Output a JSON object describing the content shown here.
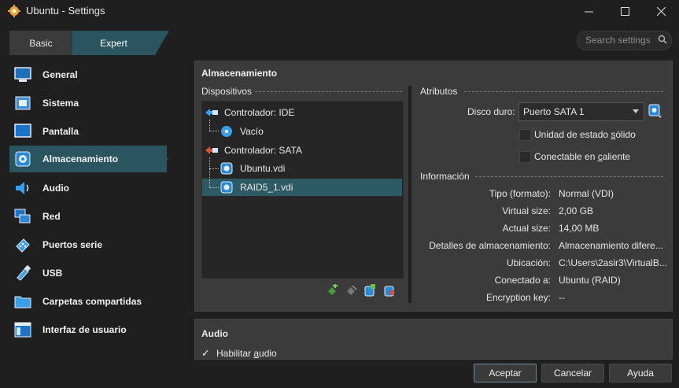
{
  "window": {
    "title": "Ubuntu - Settings",
    "controls": [
      "minimize-icon",
      "maximize-icon",
      "close-icon"
    ]
  },
  "mode": {
    "basic": "Basic",
    "expert": "Expert",
    "selected": "Expert"
  },
  "search": {
    "placeholder": "Search settings",
    "icon": "search-icon"
  },
  "sidebar": {
    "items": [
      {
        "label": "General",
        "icon": "monitor-icon"
      },
      {
        "label": "Sistema",
        "icon": "chip-icon"
      },
      {
        "label": "Pantalla",
        "icon": "display-icon"
      },
      {
        "label": "Almacenamiento",
        "icon": "disk-icon",
        "active": true
      },
      {
        "label": "Audio",
        "icon": "speaker-icon"
      },
      {
        "label": "Red",
        "icon": "network-icon"
      },
      {
        "label": "Puertos serie",
        "icon": "serial-port-icon"
      },
      {
        "label": "USB",
        "icon": "usb-icon"
      },
      {
        "label": "Carpetas compartidas",
        "icon": "folder-icon"
      },
      {
        "label": "Interfaz de usuario",
        "icon": "window-icon"
      }
    ]
  },
  "storage": {
    "title": "Almacenamiento",
    "devices_label": "Dispositivos",
    "tree": [
      {
        "label": "Controlador: IDE",
        "icon": "ide-controller-icon"
      },
      {
        "label": "Vacío",
        "icon": "optical-disk-icon"
      },
      {
        "label": "Controlador: SATA",
        "icon": "sata-controller-icon"
      },
      {
        "label": "Ubuntu.vdi",
        "icon": "hard-disk-icon"
      },
      {
        "label": "RAID5_1.vdi",
        "icon": "hard-disk-icon",
        "selected": true
      }
    ],
    "toolbar_icons": [
      "add-controller-icon",
      "remove-controller-icon",
      "add-attachment-icon",
      "remove-attachment-icon"
    ],
    "attributes": {
      "label": "Atributos",
      "disk_label": "Disco duro:",
      "disk_value": "Puerto SATA 1",
      "ssd_label_pre": "Unidad de estado ",
      "ssd_label_u": "s",
      "ssd_label_post": "ólido",
      "ssd_checked": false,
      "hot_label_pre": "Conectable en ",
      "hot_label_u": "c",
      "hot_label_post": "aliente",
      "hot_checked": false
    },
    "info": {
      "label": "Información",
      "rows": [
        {
          "key": "Tipo (formato):",
          "value": "Normal (VDI)"
        },
        {
          "key": "Virtual size:",
          "value": "2,00 GB"
        },
        {
          "key": "Actual size:",
          "value": "14,00 MB"
        },
        {
          "key": "Detalles de almacenamiento:",
          "value": "Almacenamiento difere..."
        },
        {
          "key": "Ubicación:",
          "value": "C:\\Users\\2asir3\\VirtualB..."
        },
        {
          "key": "Conectado a:",
          "value": "Ubuntu (RAID)"
        },
        {
          "key": "Encryption key:",
          "value": "--"
        }
      ]
    }
  },
  "audio": {
    "title": "Audio",
    "enable_pre": "Habilitar ",
    "enable_u": "a",
    "enable_post": "udio",
    "enabled": true,
    "check_mark": "✓"
  },
  "buttons": {
    "ok": "Aceptar",
    "cancel": "Cancelar",
    "help": "Ayuda"
  },
  "colors": {
    "accent": "#2a5560",
    "selection": "#2c5b66",
    "panel": "#3b3b3b",
    "background": "#1f1f1f"
  }
}
